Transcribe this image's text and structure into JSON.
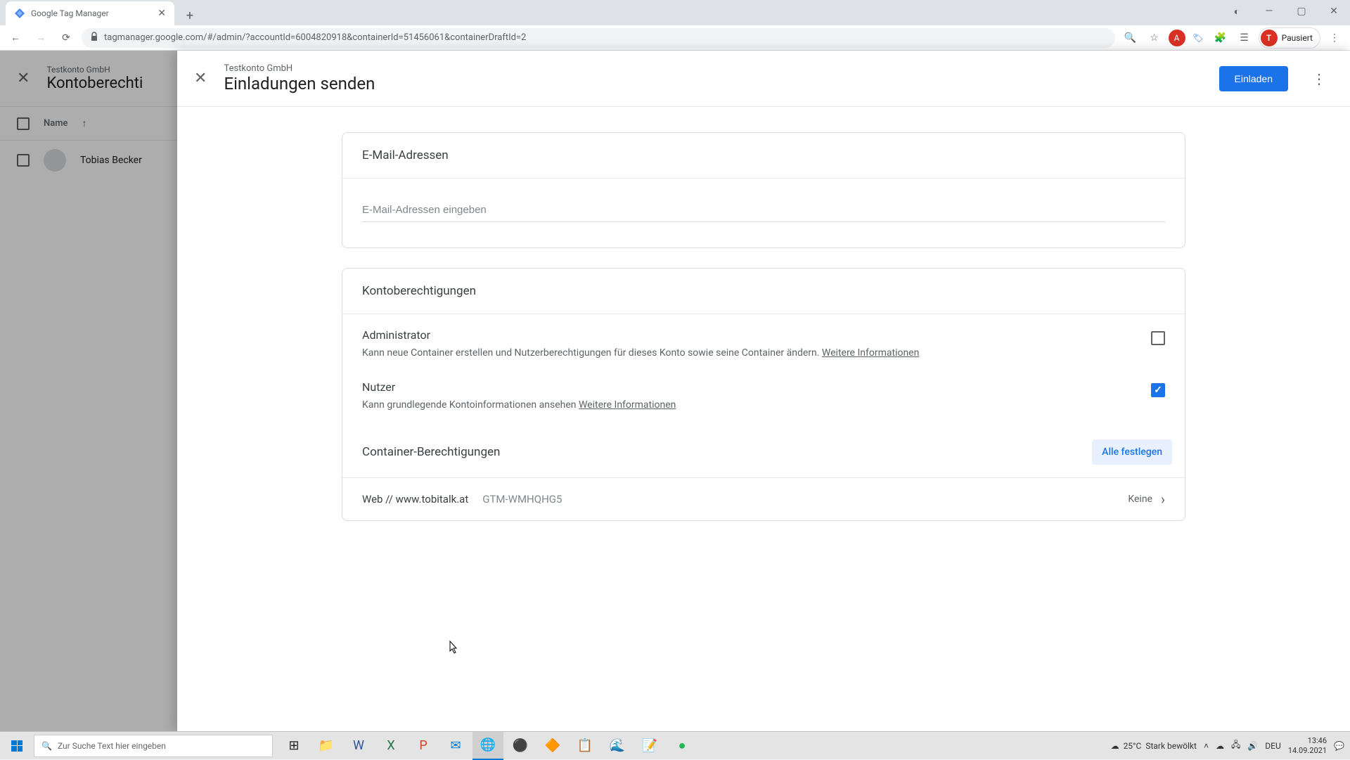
{
  "browser": {
    "tab_title": "Google Tag Manager",
    "url": "tagmanager.google.com/#/admin/?accountId=6004820918&containerId=51456061&containerDraftId=2",
    "profile_initial": "T",
    "profile_status": "Pausiert"
  },
  "background": {
    "account": "Testkonto GmbH",
    "title": "Kontoberechti",
    "name_col": "Name",
    "user_name": "Tobias Becker"
  },
  "panel": {
    "account": "Testkonto GmbH",
    "title": "Einladungen senden",
    "invite_label": "Einladen",
    "email_section_title": "E-Mail-Adressen",
    "email_placeholder": "E-Mail-Adressen eingeben",
    "perms_section_title": "Kontoberechtigungen",
    "admin_title": "Administrator",
    "admin_desc": "Kann neue Container erstellen und Nutzerberechtigungen für dieses Konto sowie seine Container ändern. ",
    "admin_link": "Weitere Informationen",
    "user_title": "Nutzer",
    "user_desc": "Kann grundlegende Kontoinformationen ansehen ",
    "user_link": "Weitere Informationen",
    "container_section_title": "Container-Berechtigungen",
    "set_all_label": "Alle festlegen",
    "container_name": "Web // www.tobitalk.at",
    "container_id": "GTM-WMHQHG5",
    "container_perm": "Keine"
  },
  "taskbar": {
    "search_placeholder": "Zur Suche Text hier eingeben",
    "weather_temp": "25°C",
    "weather_text": "Stark bewölkt",
    "lang": "DEU",
    "time": "13:46",
    "date": "14.09.2021"
  }
}
